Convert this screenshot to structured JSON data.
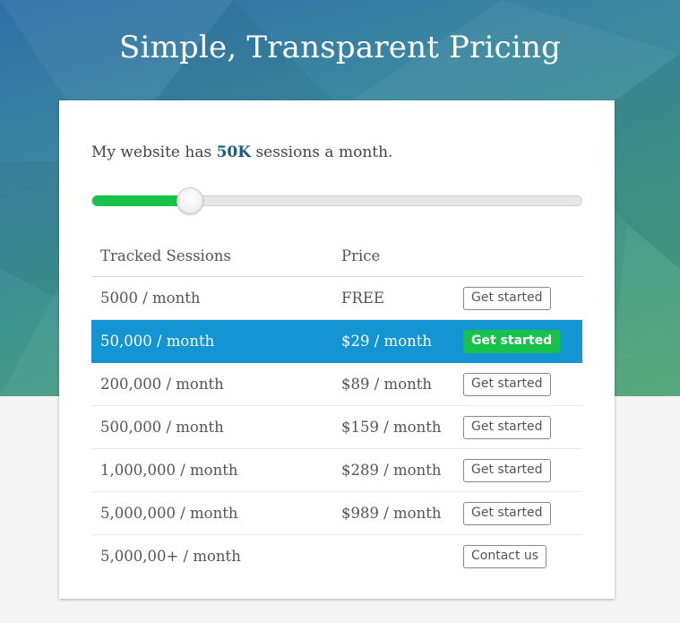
{
  "page": {
    "title": "Simple, Transparent Pricing"
  },
  "headline": {
    "prefix": "My website has",
    "sessions": "50K",
    "suffix": "sessions a month."
  },
  "slider": {
    "value_fraction": 0.2,
    "fill_color": "#17c24a",
    "track_color": "#e6e6e6"
  },
  "table": {
    "columns": [
      "Tracked Sessions",
      "Price",
      ""
    ],
    "rows": [
      {
        "sessions": "5000 / month",
        "price": "FREE",
        "action": "Get started",
        "selected": false
      },
      {
        "sessions": "50,000 / month",
        "price": "$29 / month",
        "action": "Get started",
        "selected": true
      },
      {
        "sessions": "200,000 / month",
        "price": "$89 / month",
        "action": "Get started",
        "selected": false
      },
      {
        "sessions": "500,000 / month",
        "price": "$159 / month",
        "action": "Get started",
        "selected": false
      },
      {
        "sessions": "1,000,000 / month",
        "price": "$289 / month",
        "action": "Get started",
        "selected": false
      },
      {
        "sessions": "5,000,000 / month",
        "price": "$989 / month",
        "action": "Get started",
        "selected": false
      },
      {
        "sessions": "5,000,00+ / month",
        "price": "",
        "action": "Contact us",
        "selected": false
      }
    ]
  },
  "colors": {
    "selected_row": "#1394d3",
    "accent_green": "#17c24a",
    "highlight_text": "#1b5a8a"
  }
}
